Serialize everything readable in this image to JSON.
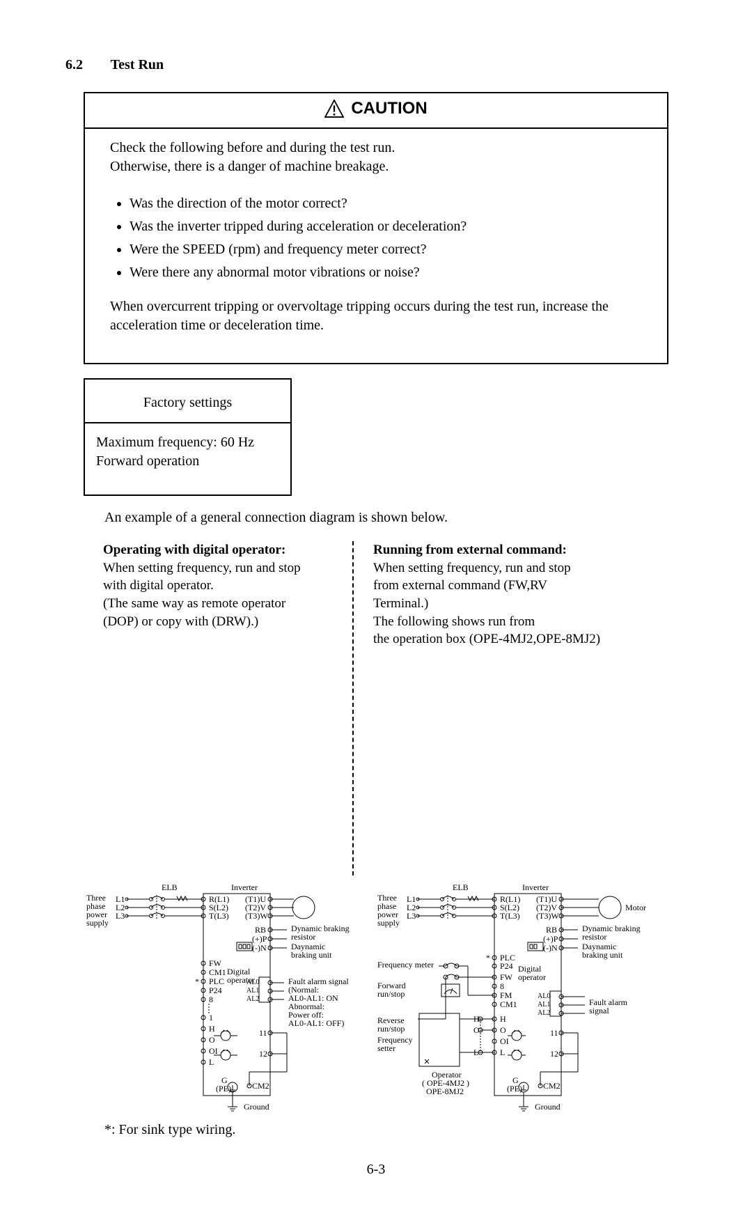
{
  "section": {
    "number": "6.2",
    "title": "Test Run"
  },
  "caution": {
    "label": "CAUTION",
    "intro1": "Check the following before and during the test run.",
    "intro2": "Otherwise, there is a danger of machine breakage.",
    "bullets": [
      "Was the direction of the motor correct?",
      "Was the inverter tripped during acceleration or deceleration?",
      "Were the SPEED (rpm) and frequency meter correct?",
      "Were there any abnormal motor vibrations or noise?"
    ],
    "outro": "When overcurrent tripping or overvoltage tripping occurs during the test run, increase the acceleration time or deceleration time."
  },
  "factory": {
    "heading": "Factory settings",
    "line1": "Maximum frequency: 60 Hz",
    "line2": "Forward operation"
  },
  "example_line": "An example of a general connection diagram is shown below.",
  "left_col": {
    "heading": "Operating with digital operator:",
    "l1": "When setting frequency, run and stop",
    "l2": "with digital operator.",
    "l3": "(The same way as remote operator",
    "l4": "(DOP) or copy with (DRW).)"
  },
  "right_col": {
    "heading": "Running from external command:",
    "l1": "When setting frequency, run and stop",
    "l2": "from external command (FW,RV Terminal.)",
    "l3": "The following shows run from",
    "l4": "the operation box (OPE-4MJ2,OPE-8MJ2)"
  },
  "diagram": {
    "three_phase": "Three\nphase\npower\nsupply",
    "elb": "ELB",
    "inverter": "Inverter",
    "L1": "L1",
    "L2": "L2",
    "L3": "L3",
    "RL1": "R(L1)",
    "SL2": "S(L2)",
    "TL3": "T(L3)",
    "T1U": "(T1)U",
    "T2V": "(T2)V",
    "T3W": "(T3)W",
    "motor": "Motor",
    "RB": "RB",
    "plusP": "(+)P",
    "minusN": "(-)N",
    "dyn1": "Dynamic braking",
    "dyn2": "resistor",
    "dyn3": "Daynamic",
    "dyn4": "braking unit",
    "FW": "FW",
    "CM1": "CM1",
    "PLC": "PLC",
    "P24": "P24",
    "eight": "8",
    "one": "1",
    "H": "H",
    "O": "O",
    "OI": "OI",
    "L": "L",
    "eleven": "11",
    "twelve": "12",
    "AL0": "AL0",
    "AL1": "AL1",
    "AL2": "AL2",
    "digital_op": "Digital\noperator",
    "fault_sig_title": "Fault alarm signal",
    "fault1": "(Normal:",
    "fault2": "AL0-AL1: ON",
    "fault3": "Abnormal:",
    "fault4": "Power off:",
    "fault5": "AL0-AL1: OFF)",
    "fault_sig_short": "Fault alarm\nsignal",
    "G": "G",
    "PE": "(PE)",
    "CM2": "CM2",
    "ground": "Ground",
    "star": "*",
    "freq_meter": "Frequency meter",
    "forward_rs": "Forward\nrun/stop",
    "reverse_rs": "Reverse\nrun/stop",
    "freq_setter": "Frequency\nsetter",
    "oper_box": "Operator\nOPE-4MJ2\nOPE-8MJ2",
    "FM": "FM"
  },
  "footnote": "*:  For sink type wiring.",
  "page": "6-3"
}
